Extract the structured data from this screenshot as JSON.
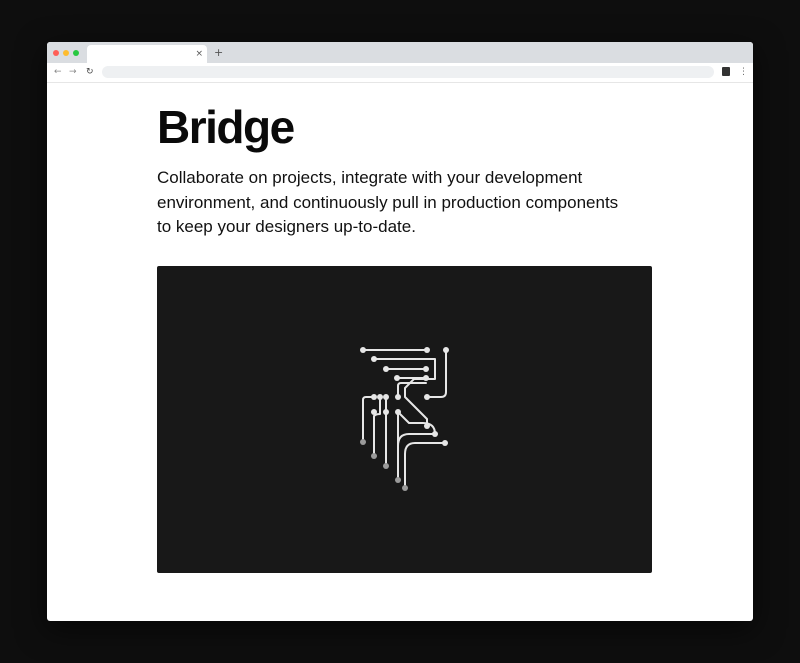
{
  "browser": {
    "tab_close_glyph": "×",
    "new_tab_glyph": "+",
    "back_glyph": "←",
    "forward_glyph": "→",
    "reload_glyph": "↻",
    "menu_glyph": "⋮",
    "icons": {
      "close": "close-icon",
      "new_tab": "plus-icon",
      "back": "arrow-left-icon",
      "forward": "arrow-right-icon",
      "reload": "reload-icon",
      "extension": "extension-icon",
      "menu": "kebab-menu-icon"
    },
    "traffic_light_colors": {
      "red": "#ff5f57",
      "yellow": "#febc2e",
      "green": "#28c840"
    }
  },
  "page": {
    "title": "Bridge",
    "description": "Collaborate on projects, integrate with your development environment, and continuously pull in production components to keep your designers up-to-date.",
    "hero": {
      "icon": "circuit-traces-illustration",
      "background_color": "#181818",
      "trace_color": "#e6e6e6"
    }
  }
}
